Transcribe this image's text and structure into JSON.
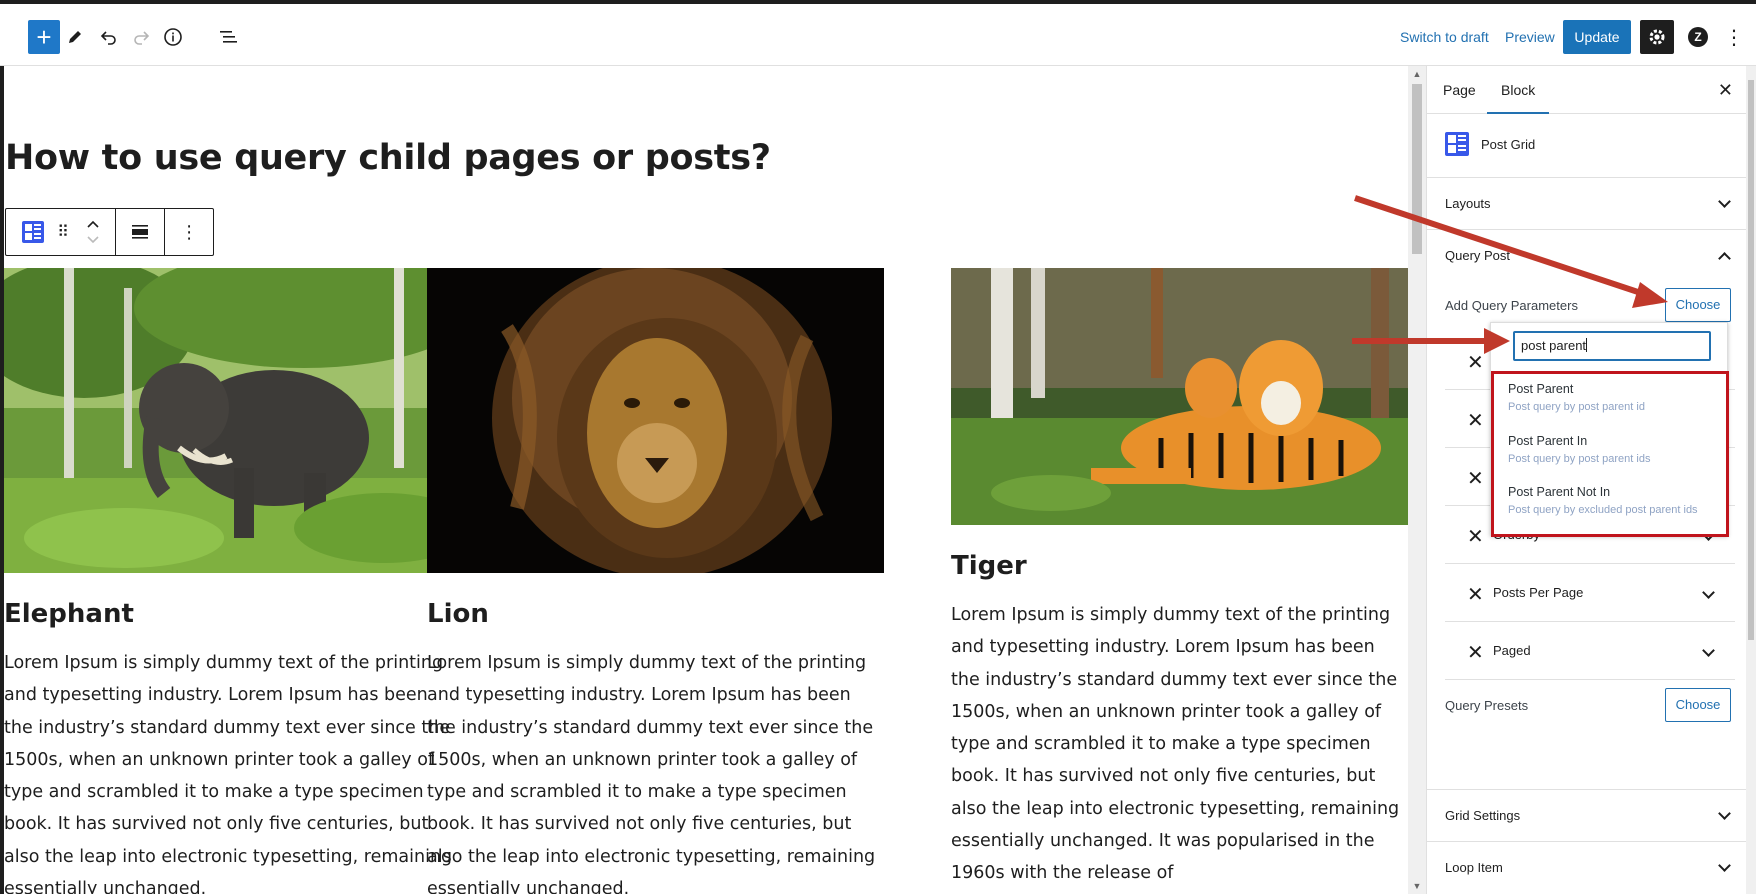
{
  "toolbar": {
    "switch_to_draft": "Switch to draft",
    "preview": "Preview",
    "update": "Update"
  },
  "content": {
    "title": "How to use query child pages or posts?",
    "cards": [
      {
        "title": "Elephant",
        "text": "Lorem Ipsum is simply dummy text of the printing and typesetting industry. Lorem Ipsum has been the industry’s standard dummy text ever since the 1500s, when an unknown printer took a galley of type and scrambled it to make a type specimen book. It has survived not only five centuries, but also the leap into electronic typesetting, remaining essentially unchanged."
      },
      {
        "title": "Lion",
        "text": "Lorem Ipsum is simply dummy text of the printing and typesetting industry. Lorem Ipsum has been the industry’s standard dummy text ever since the 1500s, when an unknown printer took a galley of type and scrambled it to make a type specimen book. It has survived not only five centuries, but also the leap into electronic typesetting, remaining essentially unchanged."
      },
      {
        "title": "Tiger",
        "text": "Lorem Ipsum is simply dummy text of the printing and typesetting industry. Lorem Ipsum has been the industry’s standard dummy text ever since the 1500s, when an unknown printer took a galley of type and scrambled it to make a type specimen book. It has survived not only five centuries, but also the leap into electronic typesetting, remaining essentially unchanged. It was popularised in the 1960s with the release of"
      }
    ]
  },
  "sidebar": {
    "tabs": [
      "Page",
      "Block"
    ],
    "block_name": "Post Grid",
    "panels": {
      "layouts": "Layouts",
      "query_post": "Query Post",
      "add_query_parameters": "Add Query Parameters",
      "choose": "Choose",
      "query_presets": "Query Presets",
      "grid_settings": "Grid Settings",
      "loop_item": "Loop Item"
    },
    "params": [
      "Orderby",
      "Posts Per Page",
      "Paged"
    ]
  },
  "dropdown": {
    "search_value": "post parent",
    "results": [
      {
        "title": "Post Parent",
        "desc": "Post query by post parent id"
      },
      {
        "title": "Post Parent In",
        "desc": "Post query by post parent ids"
      },
      {
        "title": "Post Parent Not In",
        "desc": "Post query by excluded post parent ids"
      }
    ]
  },
  "colors": {
    "accent": "#2271b1",
    "block_icon": "#3858e9",
    "annotation": "#c0392b",
    "highlight_box": "#c0141c"
  },
  "icons": {
    "add": "plus-icon",
    "tools": "pencil-icon",
    "undo": "undo-icon",
    "redo": "redo-icon",
    "details": "info-icon",
    "outline": "list-view-icon",
    "settings": "gear-icon",
    "plugin": "plugin-circle-icon",
    "more": "kebab-icon"
  }
}
